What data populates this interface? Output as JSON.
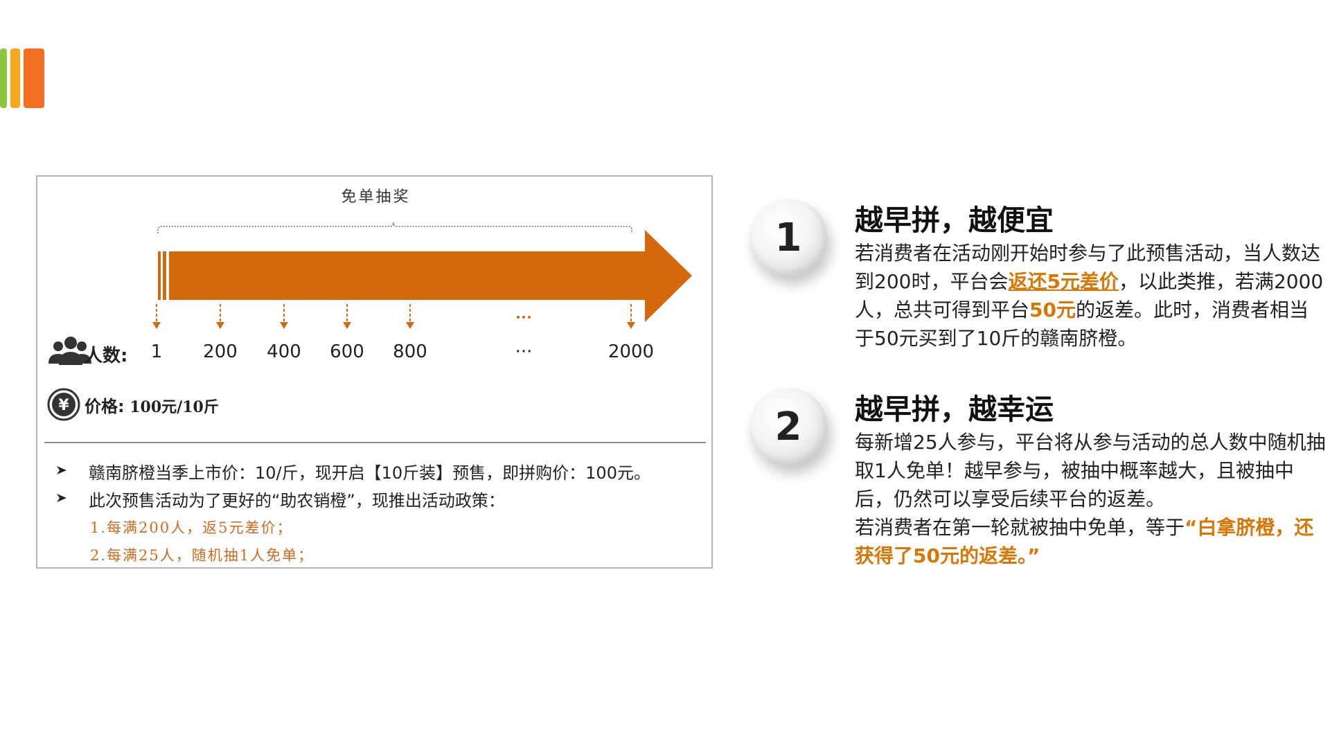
{
  "colors": {
    "orange": "#d4690c",
    "accent": "#d97706",
    "logo": [
      "#8cc63f",
      "#f7a81b",
      "#f26f21"
    ]
  },
  "figure": {
    "lottery_label": "免单抽奖",
    "people_label": "人数:",
    "ticks": [
      "1",
      "200",
      "400",
      "600",
      "800",
      "···",
      "2000"
    ],
    "price_label": "价格:",
    "price_value": "100元/10斤",
    "bullets": [
      "赣南脐橙当季上市价：10/斤，现开启【10斤装】预售，即拼购价：100元。",
      "此次预售活动为了更好的“助农销橙”，现推出活动政策："
    ],
    "policies": [
      "1.每满200人，返5元差价；",
      "2.每满25人，随机抽1人免单；"
    ],
    "icons": {
      "people": "people-group-icon",
      "price": "yen-coin-icon",
      "bullet": "arrowhead-bullet-icon"
    }
  },
  "points": [
    {
      "number": "1",
      "title": "越早拼，越便宜",
      "body": {
        "p1": "若消费者在活动刚开始时参与了此预售活动，当人数达到200时，平台会",
        "h1": "返还5元差价",
        "p2": "，以此类推，若满2000人，总共可得到平台",
        "h2": "50元",
        "p3": "的返差。此时，消费者相当于50元买到了10斤的赣南脐橙。"
      }
    },
    {
      "number": "2",
      "title": "越早拼，越幸运",
      "body": {
        "p1": "每新增25人参与，平台将从参与活动的总人数中随机抽取1人免单！越早参与，被抽中概率越大，且被抽中后，仍然可以享受后续平台的返差。",
        "p2": "若消费者在第一轮就被抽中免单，等于",
        "h1": "“白拿脐橙，还获得了50元的返差。”"
      }
    }
  ]
}
